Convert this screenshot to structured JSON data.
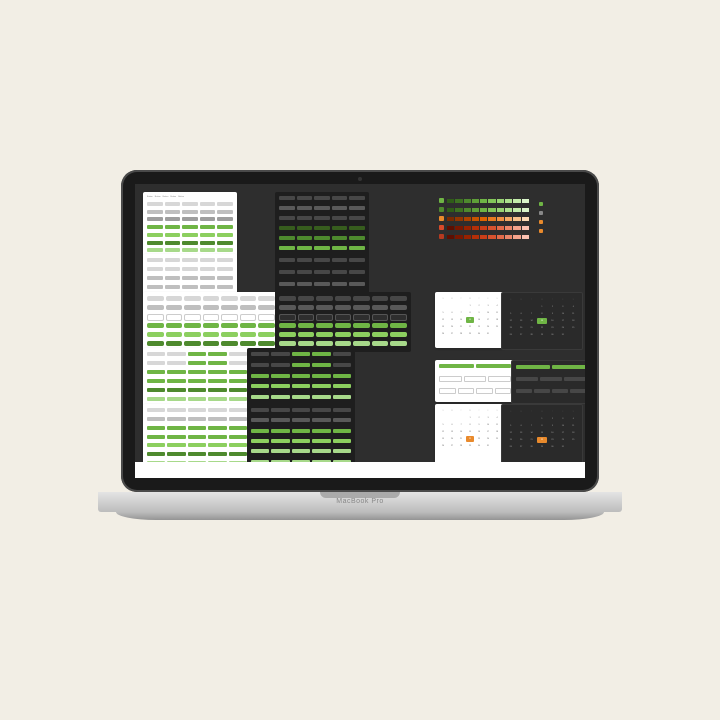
{
  "device_label": "MacBook Pro",
  "button_labels": [
    "Button",
    "Button",
    "Button",
    "Button",
    "Button"
  ],
  "ramp_green": [
    "#2f5d18",
    "#3d7221",
    "#4e8a2e",
    "#5e9e38",
    "#6fb545",
    "#82c559",
    "#97d373",
    "#ace08d",
    "#c3ecab",
    "#daf5ca"
  ],
  "ramp_orange": [
    "#7a2a00",
    "#933600",
    "#ad4300",
    "#c65300",
    "#df6400",
    "#e87a20",
    "#ef9142",
    "#f4a966",
    "#f9c28c",
    "#fddbb5"
  ],
  "ramp_red": [
    "#5e0e00",
    "#7a1700",
    "#972200",
    "#b32f08",
    "#cb3e18",
    "#d8522e",
    "#e36a49",
    "#ec8568",
    "#f4a28b",
    "#fbc1b1"
  ],
  "calendar": {
    "dow": [
      "S",
      "M",
      "T",
      "W",
      "T",
      "F",
      "S"
    ],
    "days": [
      "",
      "",
      "",
      "1",
      "2",
      "3",
      "4",
      "5",
      "6",
      "7",
      "8",
      "9",
      "10",
      "11",
      "12",
      "13",
      "14",
      "15",
      "16",
      "17",
      "18",
      "19",
      "20",
      "21",
      "22",
      "23",
      "24",
      "25",
      "26",
      "27",
      "28",
      "29",
      "30",
      "31",
      ""
    ],
    "selected_green": "15",
    "selected_orange": "22"
  },
  "colors": {
    "bg": "#f2eee5",
    "screen": "#2e2e2e",
    "green": "#6fb545",
    "orange": "#e98a2c",
    "red": "#d84a2a"
  }
}
